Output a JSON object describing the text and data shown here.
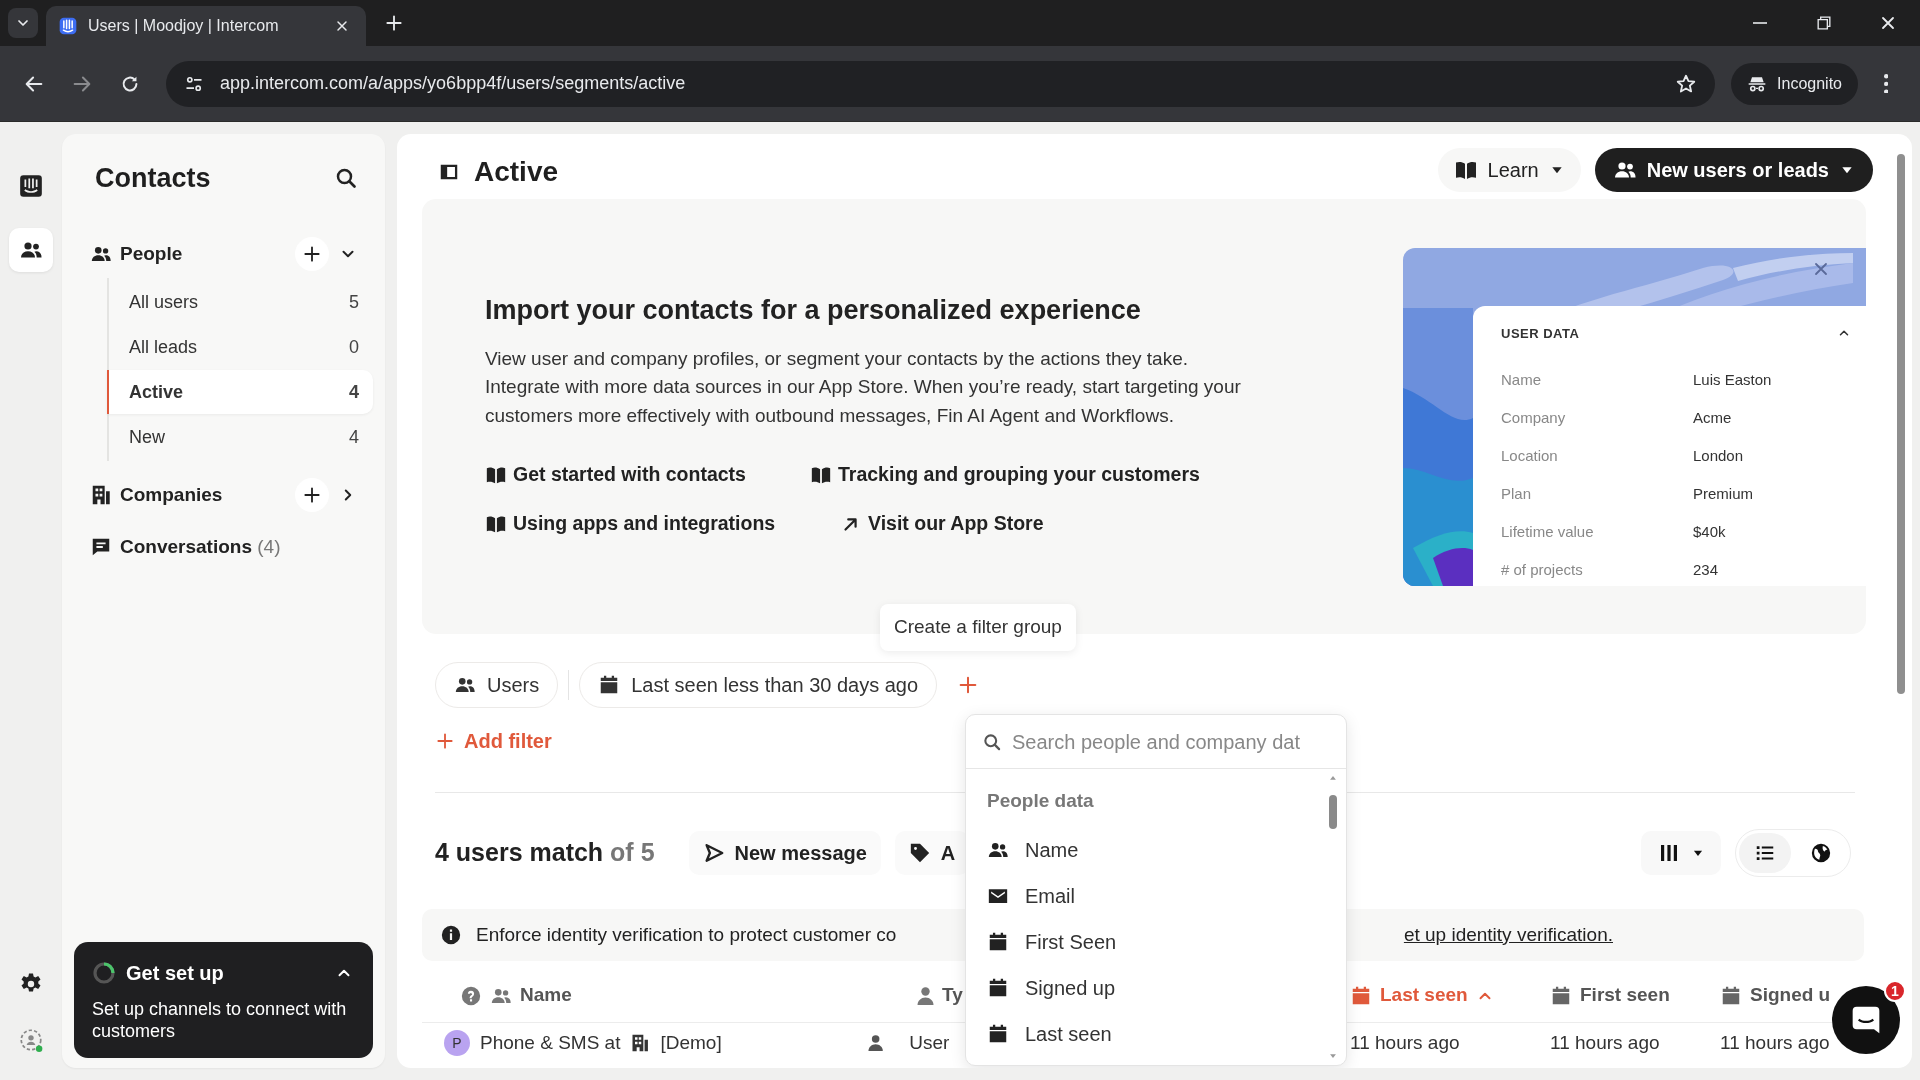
{
  "browser": {
    "tab_title": "Users | Moodjoy | Intercom",
    "url": "app.intercom.com/a/apps/yo6bpp4f/users/segments/active",
    "profile": "Incognito"
  },
  "sidebar": {
    "title": "Contacts",
    "people": {
      "label": "People",
      "expanded": true,
      "items": [
        {
          "label": "All users",
          "count": "5",
          "selected": false
        },
        {
          "label": "All leads",
          "count": "0",
          "selected": false
        },
        {
          "label": "Active",
          "count": "4",
          "selected": true
        },
        {
          "label": "New",
          "count": "4",
          "selected": false
        }
      ]
    },
    "companies": {
      "label": "Companies",
      "expanded": false
    },
    "conversations": {
      "label": "Conversations",
      "count": "(4)"
    }
  },
  "setup": {
    "title": "Get set up",
    "text": "Set up channels to connect with customers"
  },
  "page": {
    "title": "Active",
    "learn": "Learn",
    "primary": "New users or leads"
  },
  "banner": {
    "heading": "Import your contacts for a personalized experience",
    "body": "View user and company profiles, or segment your contacts by the actions they take. Integrate with more data sources in our App Store. When you’re ready, start targeting your customers more effectively with outbound messages, Fin AI Agent and Workflows.",
    "links": [
      {
        "kind": "guide",
        "label": "Get started with contacts"
      },
      {
        "kind": "guide",
        "label": "Tracking and grouping your customers"
      },
      {
        "kind": "guide",
        "label": "Using apps and integrations"
      },
      {
        "kind": "external",
        "label": "Visit our App Store"
      }
    ],
    "preview": {
      "title": "USER DATA",
      "fields": [
        {
          "label": "Name",
          "value": "Luis Easton"
        },
        {
          "label": "Company",
          "value": "Acme"
        },
        {
          "label": "Location",
          "value": "London"
        },
        {
          "label": "Plan",
          "value": "Premium"
        },
        {
          "label": "Lifetime value",
          "value": "$40k"
        },
        {
          "label": "# of projects",
          "value": "234"
        }
      ]
    }
  },
  "tooltip": "Create a filter group",
  "filters": {
    "chips": [
      {
        "kind": "audience",
        "label": "Users"
      },
      {
        "kind": "date",
        "label": "Last seen less than 30 days ago"
      }
    ],
    "add": "Add filter"
  },
  "results": {
    "count": "4 users match",
    "total": "of 5",
    "actions": [
      {
        "kind": "send",
        "label": "New message"
      },
      {
        "kind": "tag",
        "label": "A"
      }
    ],
    "views": [
      {
        "kind": "list",
        "selected": true
      },
      {
        "kind": "map",
        "selected": false
      }
    ]
  },
  "notice": {
    "text": "Enforce identity verification to protect customer co",
    "link": "et up identity verification."
  },
  "table": {
    "columns": [
      {
        "kind": "name",
        "label": "Name",
        "sorted": false
      },
      {
        "kind": "type",
        "label": "Ty",
        "sorted": false
      },
      {
        "kind": "date",
        "label": "Last seen",
        "sorted": true
      },
      {
        "kind": "date",
        "label": "First seen",
        "sorted": false
      },
      {
        "kind": "date",
        "label": "Signed u",
        "sorted": false
      }
    ],
    "rows": [
      {
        "avatar": "P",
        "name": "Phone & SMS at",
        "company": "[Demo]",
        "type": "User",
        "last_seen": "11 hours ago",
        "first_seen": "11 hours ago",
        "signed_up": "11 hours ago"
      }
    ]
  },
  "dropdown": {
    "placeholder": "Search people and company dat",
    "section": "People data",
    "items": [
      {
        "kind": "people",
        "label": "Name"
      },
      {
        "kind": "email",
        "label": "Email"
      },
      {
        "kind": "date",
        "label": "First Seen"
      },
      {
        "kind": "date",
        "label": "Signed up"
      },
      {
        "kind": "date",
        "label": "Last seen"
      }
    ]
  },
  "messenger": {
    "badge": "1"
  }
}
